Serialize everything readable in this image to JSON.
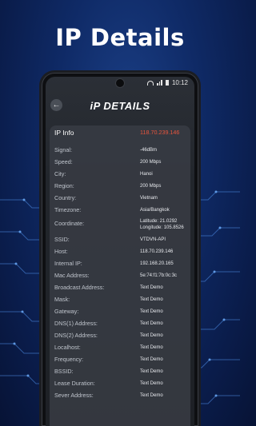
{
  "headline": "IP Details",
  "status_bar": {
    "time": "10:12"
  },
  "header": {
    "title": "iP DETAILS"
  },
  "ip_info": {
    "label": "IP Info",
    "value": "118.70.239.146",
    "rows": [
      {
        "label": "Signal:",
        "value": "-46dBm"
      },
      {
        "label": "Speed:",
        "value": "200 Mbps"
      },
      {
        "label": "City:",
        "value": "Hanoi"
      },
      {
        "label": "Region:",
        "value": "200 Mbps"
      },
      {
        "label": "Country:",
        "value": "Vietnam"
      },
      {
        "label": "Timezone:",
        "value": "Asia/Bangkok"
      },
      {
        "label": "Coordinate:",
        "value": "Latitude: 21.0292",
        "value2": "Longitude: 105.8526"
      },
      {
        "label": "SSID:",
        "value": "VTDVN-API"
      },
      {
        "label": "Host:",
        "value": "118.70.239.146"
      },
      {
        "label": "Internal IP:",
        "value": "192.168.20.165"
      },
      {
        "label": "Mac Address:",
        "value": "5e:74:f1:7b:0c:3c"
      },
      {
        "label": "Broadcast Address:",
        "value": "Text Demo"
      },
      {
        "label": "Mask:",
        "value": "Text Demo"
      },
      {
        "label": "Gateway:",
        "value": "Text Demo"
      },
      {
        "label": "DNS(1) Address:",
        "value": "Text Demo"
      },
      {
        "label": "DNS(2) Address:",
        "value": "Text Demo"
      },
      {
        "label": "Localhost:",
        "value": "Text Demo"
      },
      {
        "label": "Frequency:",
        "value": "Text Demo"
      },
      {
        "label": "BSSID:",
        "value": "Text Demo"
      },
      {
        "label": "Lease Duration:",
        "value": "Text Demo"
      },
      {
        "label": "Sever Address:",
        "value": "Text Demo"
      }
    ]
  }
}
